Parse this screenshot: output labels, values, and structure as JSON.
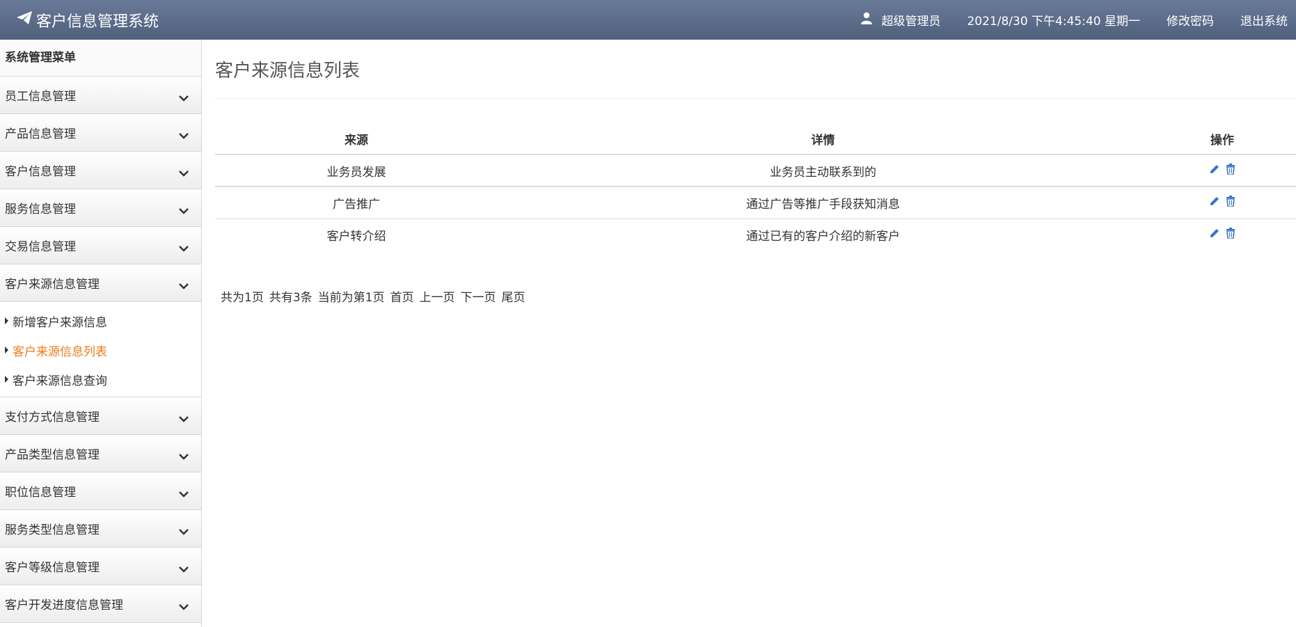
{
  "header": {
    "title": "客户信息管理系统",
    "user": "超级管理员",
    "datetime": "2021/8/30 下午4:45:40 星期一",
    "change_password": "修改密码",
    "logout": "退出系统",
    "bg_color": "#5a6a88"
  },
  "sidebar": {
    "title": "系统管理菜单",
    "items_top": [
      {
        "label": "员工信息管理"
      },
      {
        "label": "产品信息管理"
      },
      {
        "label": "客户信息管理"
      },
      {
        "label": "服务信息管理"
      },
      {
        "label": "交易信息管理"
      },
      {
        "label": "客户来源信息管理"
      }
    ],
    "sub_items": [
      {
        "label": "新增客户来源信息"
      },
      {
        "label": "客户来源信息列表"
      },
      {
        "label": "客户来源信息查询"
      }
    ],
    "items_bottom": [
      {
        "label": "支付方式信息管理"
      },
      {
        "label": "产品类型信息管理"
      },
      {
        "label": "职位信息管理"
      },
      {
        "label": "服务类型信息管理"
      },
      {
        "label": "客户等级信息管理"
      },
      {
        "label": "客户开发进度信息管理"
      }
    ],
    "active_color": "#f07a1a"
  },
  "main": {
    "title": "客户来源信息列表",
    "columns": {
      "source": "来源",
      "detail": "详情",
      "ops": "操作"
    },
    "rows": [
      {
        "source": "业务员发展",
        "detail": "业务员主动联系到的"
      },
      {
        "source": "广告推广",
        "detail": "通过广告等推广手段获知消息"
      },
      {
        "source": "客户转介绍",
        "detail": "通过已有的客户介绍的新客户"
      }
    ],
    "icons": {
      "edit": "pencil-icon",
      "delete": "trash-icon",
      "color": "#3a78c3"
    },
    "pager": {
      "total_pages": "共为1页",
      "total_records": "共有3条",
      "current": "当前为第1页",
      "first": "首页",
      "prev": "上一页",
      "next": "下一页",
      "last": "尾页"
    }
  }
}
